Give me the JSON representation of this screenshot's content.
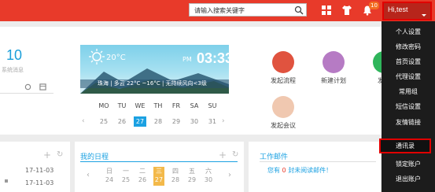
{
  "header": {
    "search_placeholder": "请输入搜索关键字",
    "notification_count": "10",
    "username": "Hi,test"
  },
  "dashboard": {
    "message_count": "10",
    "message_label": "系统消息",
    "weather": {
      "temperature": "20°C",
      "ampm": "PM",
      "time": "03:33",
      "detail": "珠海 | 多云 22°C ~16°C | 无持续风向<3级"
    },
    "calendar": {
      "weekdays": [
        "MO",
        "TU",
        "WE",
        "TH",
        "FR",
        "SA",
        "SU"
      ],
      "days": [
        "25",
        "26",
        "27",
        "28",
        "29",
        "30",
        "31"
      ],
      "today_index": 2
    },
    "apps": [
      {
        "label": "发起流程",
        "color": "#e0533f"
      },
      {
        "label": "新建计划",
        "color": "#b67bc4"
      },
      {
        "label": "发起",
        "color": "#2fb55b"
      },
      {
        "label": "发起会议",
        "color": "#f0c8b0"
      }
    ]
  },
  "lower": {
    "list_dates": [
      "17-11-03",
      "17-11-03"
    ],
    "schedule_title": "我的日程",
    "schedule_days": [
      {
        "w": "日",
        "d": "24"
      },
      {
        "w": "一",
        "d": "25"
      },
      {
        "w": "二",
        "d": "26"
      },
      {
        "w": "三",
        "d": "27"
      },
      {
        "w": "四",
        "d": "28"
      },
      {
        "w": "五",
        "d": "29"
      },
      {
        "w": "六",
        "d": "30"
      }
    ],
    "schedule_today_index": 3,
    "mail_title": "工作邮件",
    "mail_text_prefix": "您有",
    "mail_count": "0",
    "mail_text_suffix": "封未阅读邮件！"
  },
  "user_menu": {
    "items": [
      "个人设置",
      "修改密码",
      "首页设置",
      "代理设置",
      "常用组",
      "短信设置",
      "友情链接",
      "通讯录",
      "锁定账户",
      "退出账户"
    ],
    "highlighted": "通讯录"
  },
  "colors": {
    "topbar": "#e83a2a",
    "accent": "#1ba1e2",
    "menu_bg": "#1c1c1c",
    "highlight_border": "#e00000"
  }
}
